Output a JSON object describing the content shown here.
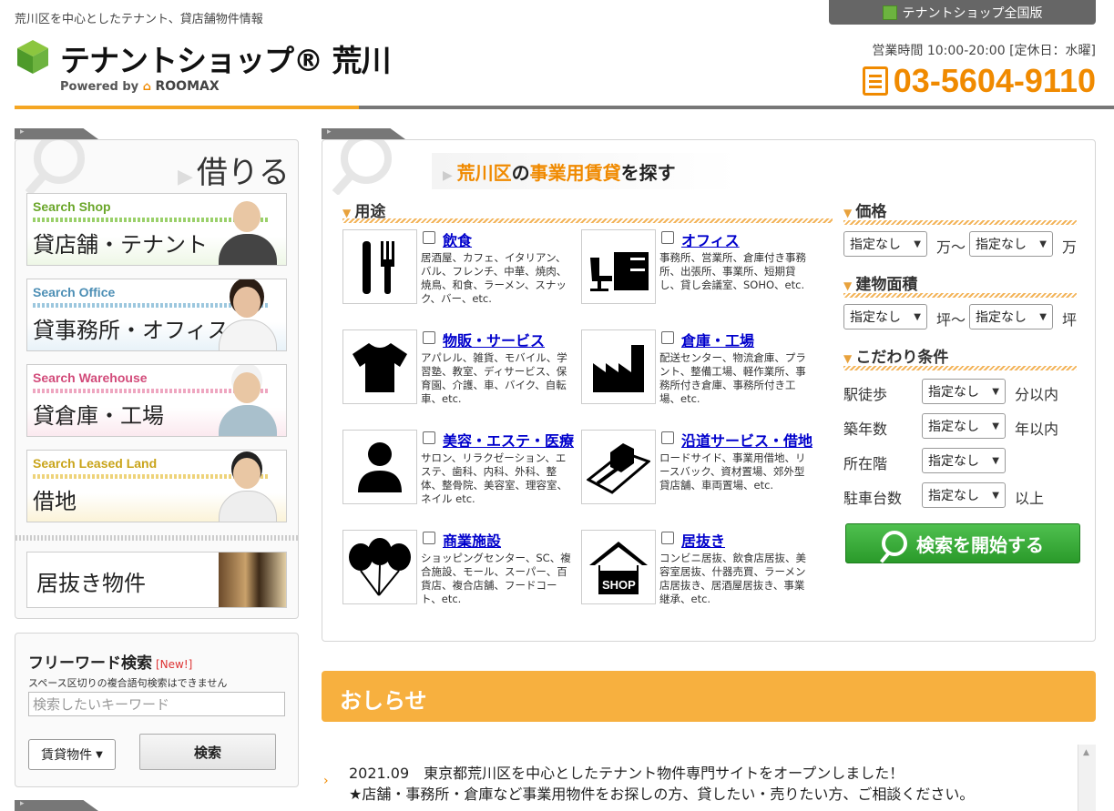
{
  "header": {
    "tagline": "荒川区を中心としたテナント、貸店舗物件情報",
    "logo_text": "テナントショップ® 荒川",
    "logo_sub_powered": "Powered by",
    "logo_sub_brand": "ROOMAX",
    "national_link": "テナントショップ全国版",
    "hours": "営業時間 10:00-20:00 [定休日：水曜]",
    "phone": "03-5604-9110"
  },
  "rent_panel": {
    "title": "借りる",
    "cards": [
      {
        "en": "Search Shop",
        "jp": "貸店舗・テナント"
      },
      {
        "en": "Search Office",
        "jp": "貸事務所・オフィス"
      },
      {
        "en": "Search Warehouse",
        "jp": "貸倉庫・工場"
      },
      {
        "en": "Search Leased Land",
        "jp": "借地"
      }
    ],
    "inuki": "居抜き物件"
  },
  "freeword": {
    "title": "フリーワード検索",
    "new_badge": "[New!]",
    "note": "スペース区切りの複合語句検索はできません",
    "placeholder": "検索したいキーワード",
    "select_value": "賃貸物件",
    "button": "検索"
  },
  "search": {
    "title_part1": "荒川区",
    "title_part2": "の",
    "title_part3": "事業用賃貸",
    "title_part4": "を探す",
    "use_heading": "用途",
    "uses": [
      {
        "name": "飲食",
        "desc": "居酒屋、カフェ、イタリアン、バル、フレンチ、中華、焼肉、焼鳥、和食、ラーメン、スナック、バー、etc.",
        "icon": "fork-knife-icon"
      },
      {
        "name": "オフィス",
        "desc": "事務所、営業所、倉庫付き事務所、出張所、事業所、短期貸し、貸し会議室、SOHO、etc.",
        "icon": "office-desk-icon"
      },
      {
        "name": "物販・サービス",
        "desc": "アパレル、雑貨、モバイル、学習塾、教室、ディサービス、保育園、介護、車、バイク、自転車、etc.",
        "icon": "tshirt-icon"
      },
      {
        "name": "倉庫・工場",
        "desc": "配送センター、物流倉庫、プラント、整備工場、軽作業所、事務所付き倉庫、事務所付き工場、etc.",
        "icon": "factory-icon"
      },
      {
        "name": "美容・エステ・医療",
        "desc": "サロン、リラクゼーション、エステ、歯科、内科、外科、整体、整骨院、美容室、理容室、ネイル etc.",
        "icon": "person-icon"
      },
      {
        "name": "沿道サービス・借地",
        "desc": "ロードサイド、事業用借地、リースバック、資材置場、郊外型貸店舗、車両置場、etc.",
        "icon": "roadside-icon"
      },
      {
        "name": "商業施設",
        "desc": "ショッピングセンター、SC、複合施設、モール、スーパー、百貨店、複合店舗、フードコート、etc.",
        "icon": "balloons-icon"
      },
      {
        "name": "居抜き",
        "desc": "コンビニ居抜、飲食店居抜、美容室居抜、什器売買、ラーメン店居抜き、居酒屋居抜き、事業継承、etc.",
        "icon": "shop-house-icon"
      }
    ],
    "price_heading": "価格",
    "price_unit_mid": "万〜",
    "price_unit_end": "万",
    "area_heading": "建物面積",
    "area_unit_mid": "坪〜",
    "area_unit_end": "坪",
    "cond_heading": "こだわり条件",
    "select_default": "指定なし",
    "conditions": [
      {
        "label": "駅徒歩",
        "suffix": "分以内"
      },
      {
        "label": "築年数",
        "suffix": "年以内"
      },
      {
        "label": "所在階",
        "suffix": ""
      },
      {
        "label": "駐車台数",
        "suffix": "以上"
      }
    ],
    "start_button": "検索を開始する"
  },
  "news": {
    "title": "おしらせ",
    "line1": "2021.09　東京都荒川区を中心としたテナント物件専門サイトをオープンしました！",
    "line2": "★店舗・事務所・倉庫など事業用物件をお探しの方、貸したい・売りたい方、ご相談ください。"
  },
  "colors": {
    "accent_orange": "#f08a00",
    "news_bar": "#f7b03f",
    "start_green": "#2a9a2a",
    "logo_green": "#6cb33f"
  }
}
